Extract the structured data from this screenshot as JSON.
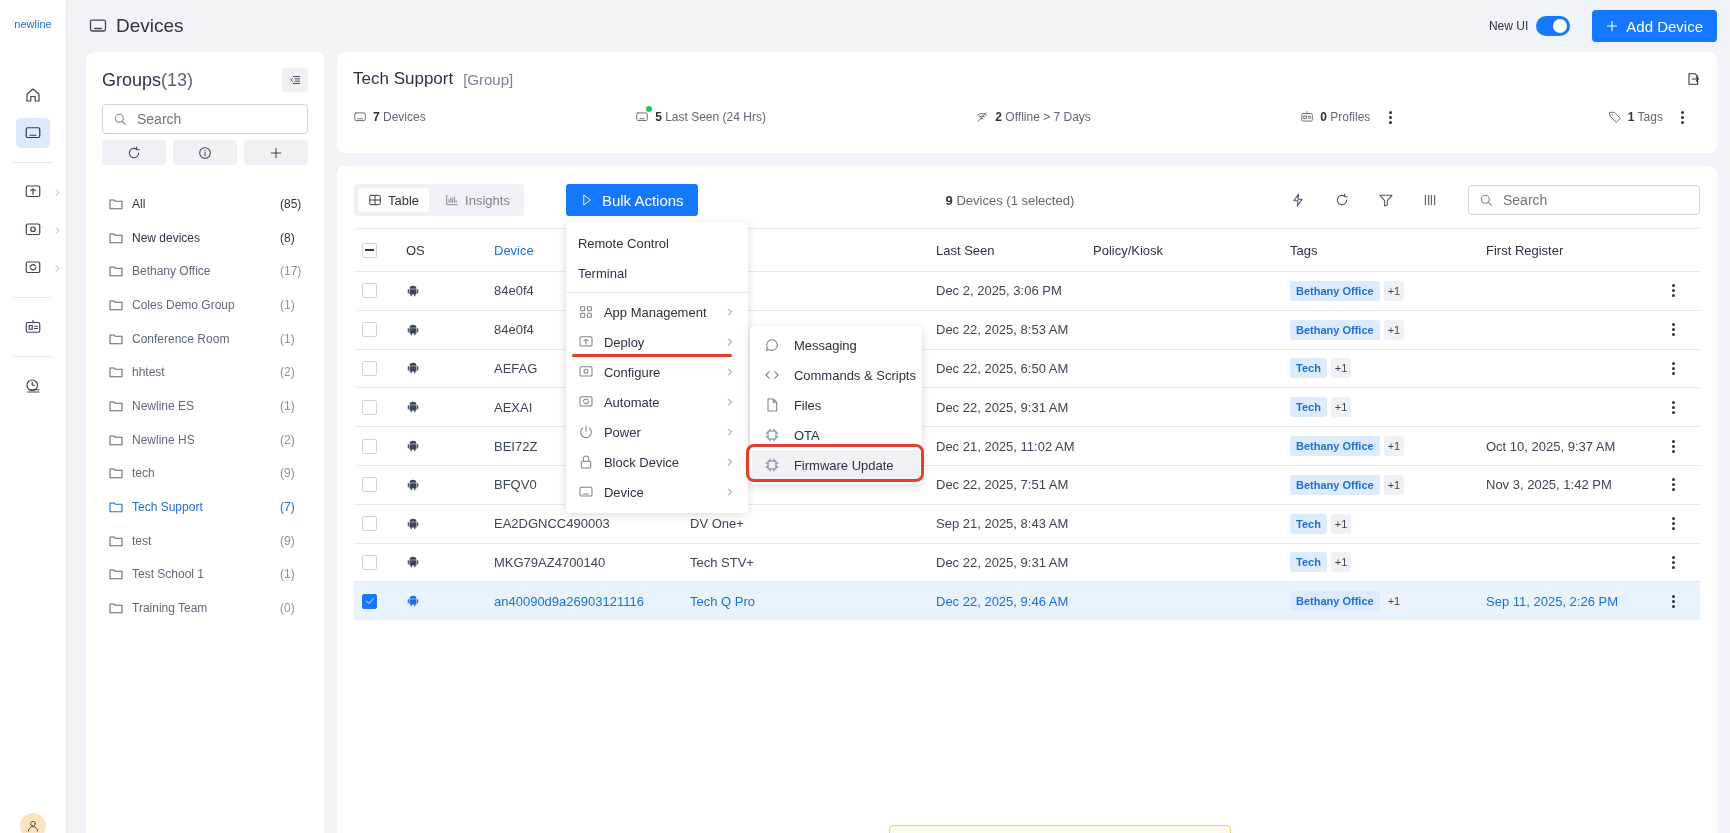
{
  "rail": {
    "logo": "newline",
    "items": [
      {
        "selected": false,
        "expandable": false
      },
      {
        "selected": true,
        "expandable": false
      },
      {
        "selected": false,
        "expandable": true
      },
      {
        "selected": false,
        "expandable": true
      },
      {
        "selected": false,
        "expandable": true
      },
      {
        "selected": false,
        "expandable": false
      },
      {
        "selected": false,
        "expandable": false
      }
    ]
  },
  "page": {
    "title": "Devices",
    "toggle": {
      "label": "New UI",
      "on": true
    },
    "add_button": "Add Device"
  },
  "groups": {
    "title": "Groups",
    "count": "(13)",
    "search_placeholder": "Search",
    "items": [
      {
        "name": "All",
        "count": "(85)",
        "selected": false,
        "emphasized": true
      },
      {
        "name": "New devices",
        "count": "(8)",
        "selected": false,
        "emphasized": true
      },
      {
        "name": "Bethany Office",
        "count": "(17)",
        "selected": false,
        "emphasized": false
      },
      {
        "name": "Coles Demo Group",
        "count": "(1)",
        "selected": false,
        "emphasized": false
      },
      {
        "name": "Conference Room",
        "count": "(1)",
        "selected": false,
        "emphasized": false
      },
      {
        "name": "hhtest",
        "count": "(2)",
        "selected": false,
        "emphasized": false
      },
      {
        "name": "Newline ES",
        "count": "(1)",
        "selected": false,
        "emphasized": false
      },
      {
        "name": "Newline HS",
        "count": "(2)",
        "selected": false,
        "emphasized": false
      },
      {
        "name": "tech",
        "count": "(9)",
        "selected": false,
        "emphasized": false
      },
      {
        "name": "Tech Support",
        "count": "(7)",
        "selected": true,
        "emphasized": false
      },
      {
        "name": "test",
        "count": "(9)",
        "selected": false,
        "emphasized": false
      },
      {
        "name": "Test School 1",
        "count": "(1)",
        "selected": false,
        "emphasized": false
      },
      {
        "name": "Training Team",
        "count": "(0)",
        "selected": false,
        "emphasized": false
      }
    ]
  },
  "summary": {
    "name": "Tech Support",
    "type": "[Group]",
    "stats": [
      {
        "kind": "plain",
        "value": "7",
        "label": "Devices"
      },
      {
        "kind": "live",
        "value": "5",
        "label": "Last Seen (24 Hrs)"
      },
      {
        "kind": "plain",
        "value": "2",
        "label": "Offline > 7 Days"
      },
      {
        "kind": "menu",
        "value": "0",
        "label": "Profiles"
      },
      {
        "kind": "menu",
        "value": "1",
        "label": "Tags"
      }
    ]
  },
  "table": {
    "view_tabs": [
      {
        "label": "Table",
        "selected": true
      },
      {
        "label": "Insights",
        "selected": false
      }
    ],
    "bulk_button": "Bulk Actions",
    "count": "9",
    "count_label": "Devices (1 selected)",
    "search_placeholder": "Search",
    "header_checkbox": {
      "indeterminate": true
    },
    "columns": [
      {
        "label": "OS",
        "active": false
      },
      {
        "label": "Device",
        "active": true
      },
      {
        "label": "Last Seen",
        "active": false
      },
      {
        "label": "Policy/Kiosk",
        "active": false
      },
      {
        "label": "Tags",
        "active": false
      },
      {
        "label": "First Register",
        "active": false
      }
    ],
    "rows": [
      {
        "checked": false,
        "device": "84e0f4",
        "last_seen": "Dec 2, 2025, 3:06 PM",
        "tag": "Bethany Office",
        "extra_tags": "+1"
      },
      {
        "checked": false,
        "device": "84e0f4",
        "last_seen": "Dec 22, 2025, 8:53 AM",
        "tag": "Bethany Office",
        "extra_tags": "+1"
      },
      {
        "checked": false,
        "device": "AEFAG",
        "last_seen": "Dec 22, 2025, 6:50 AM",
        "tag": "Tech",
        "extra_tags": "+1"
      },
      {
        "checked": false,
        "device": "AEXAI",
        "last_seen": "Dec 22, 2025, 9:31 AM",
        "tag": "Tech",
        "extra_tags": "+1"
      },
      {
        "checked": false,
        "device": "BEI72Z",
        "last_seen": "Dec 21, 2025, 11:02 AM",
        "tag": "Bethany Office",
        "extra_tags": "+1",
        "first_register": "Oct 10, 2025, 9:37 AM"
      },
      {
        "checked": false,
        "device": "BFQV0",
        "last_seen": "Dec 22, 2025, 7:51 AM",
        "tag": "Bethany Office",
        "extra_tags": "+1",
        "first_register": "Nov 3, 2025, 1:42 PM"
      },
      {
        "checked": false,
        "device": "EA2DGNCC490003",
        "model": "DV One+",
        "last_seen": "Sep 21, 2025, 8:43 AM",
        "tag": "Tech",
        "extra_tags": "+1"
      },
      {
        "checked": false,
        "device": "MKG79AZ4700140",
        "model": "Tech STV+",
        "last_seen": "Dec 22, 2025, 9:31 AM",
        "tag": "Tech",
        "extra_tags": "+1"
      },
      {
        "checked": true,
        "device": "an40090d9a26903121116",
        "model": "Tech Q Pro",
        "last_seen": "Dec 22, 2025, 9:46 AM",
        "tag": "Bethany Office",
        "extra_tags": "+1",
        "first_register": "Sep 11, 2025, 2:26 PM"
      }
    ]
  },
  "bulk_menu": {
    "items": [
      {
        "kind": "plain",
        "label": "Remote Control",
        "annotated": false
      },
      {
        "kind": "plain",
        "label": "Terminal",
        "annotated": false
      },
      {
        "kind": "submenu",
        "label": "App Management",
        "annotated": false
      },
      {
        "kind": "submenu",
        "label": "Deploy",
        "annotated": true
      },
      {
        "kind": "submenu",
        "label": "Configure",
        "annotated": false
      },
      {
        "kind": "submenu",
        "label": "Automate",
        "annotated": false
      },
      {
        "kind": "submenu",
        "label": "Power",
        "annotated": false
      },
      {
        "kind": "submenu",
        "label": "Block Device",
        "annotated": false
      },
      {
        "kind": "submenu",
        "label": "Device",
        "annotated": false
      }
    ],
    "submenu": [
      {
        "label": "Messaging",
        "highlighted": false,
        "annotated": false
      },
      {
        "label": "Commands & Scripts",
        "highlighted": false,
        "annotated": false
      },
      {
        "label": "Files",
        "highlighted": false,
        "annotated": false
      },
      {
        "label": "OTA",
        "highlighted": false,
        "annotated": false
      },
      {
        "label": "Firmware Update",
        "highlighted": true,
        "annotated": true
      }
    ]
  },
  "notice": {
    "visible": true
  }
}
